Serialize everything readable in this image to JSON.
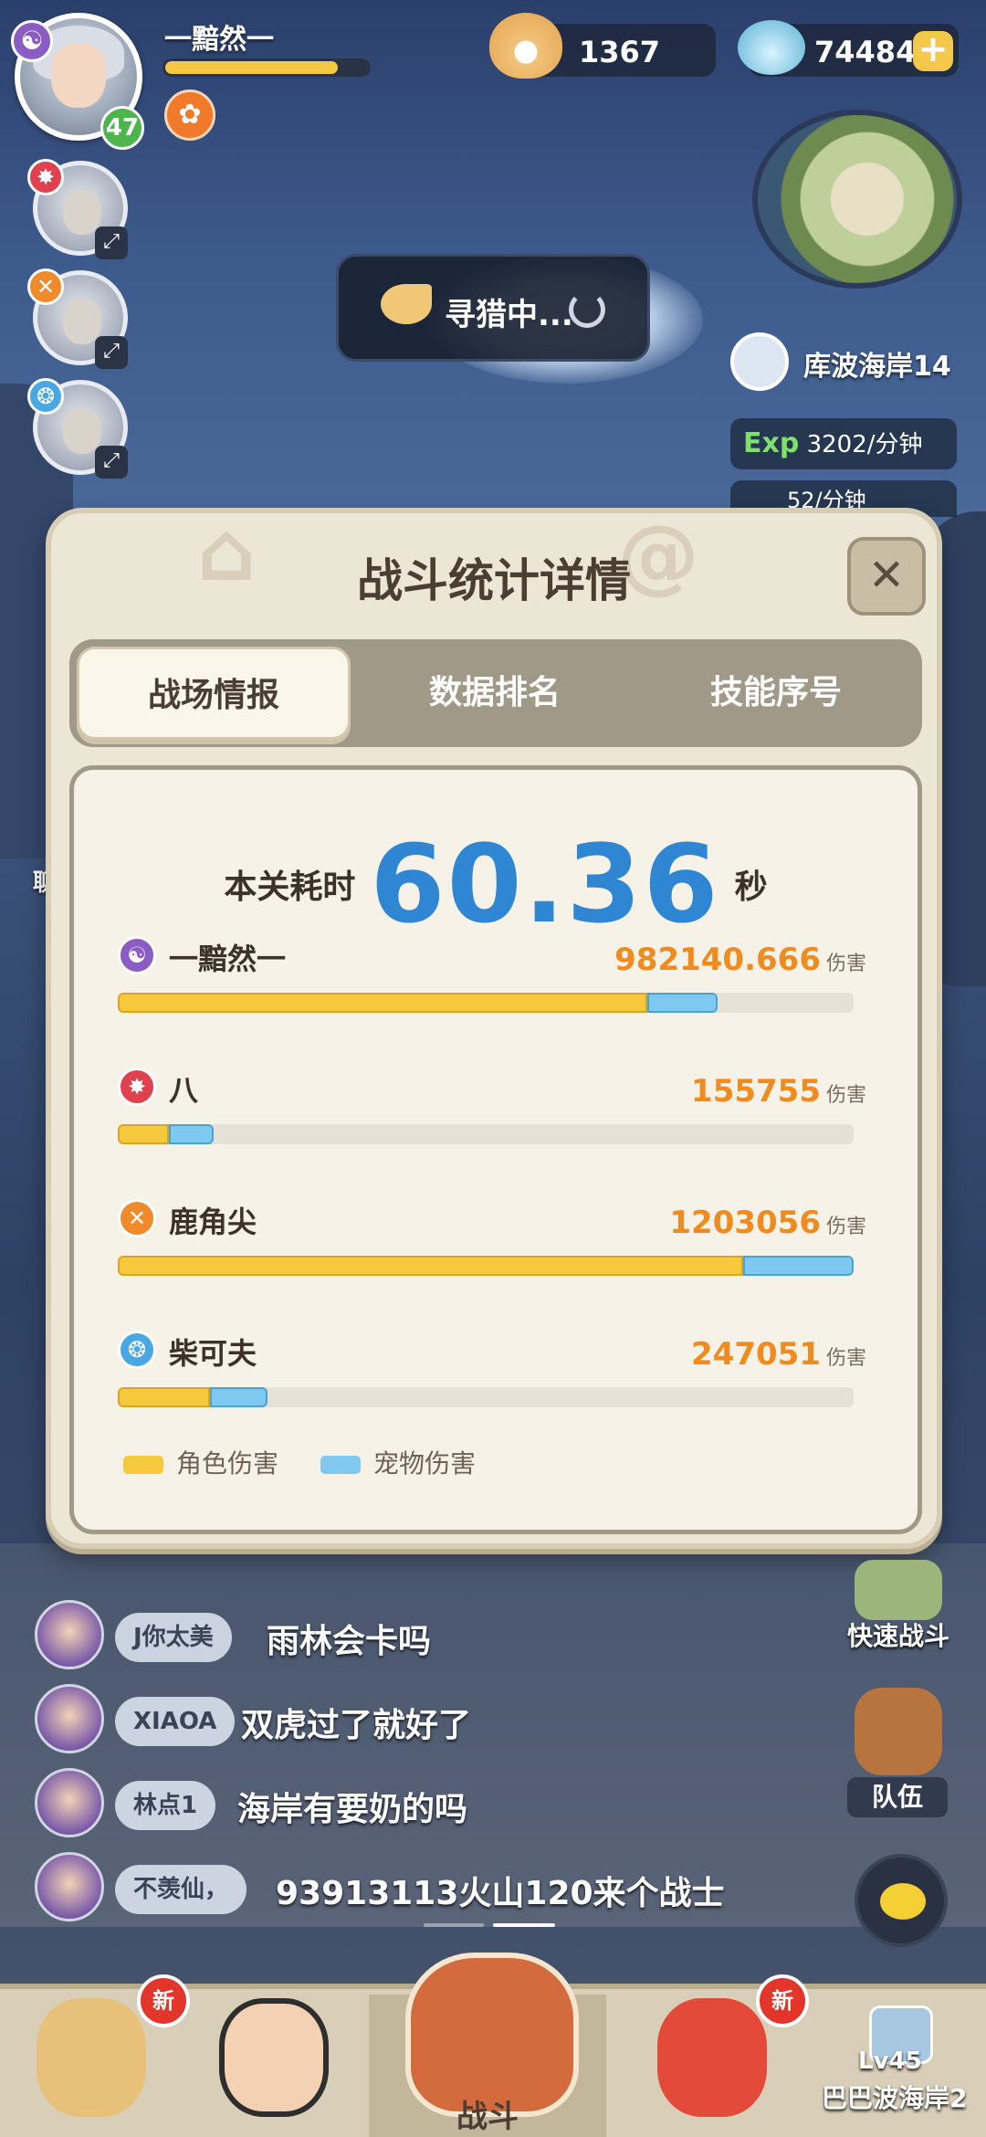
{
  "player": {
    "name": "一黯然一",
    "level": "47",
    "exp_progress": 0.85
  },
  "currency": {
    "pearls": "1367",
    "shells": "74484"
  },
  "hunting": {
    "label": "寻猎中..."
  },
  "location": {
    "name": "库波海岸14",
    "exp_label": "Exp",
    "exp_rate": "3202/分钟",
    "second_rate": "52/分钟"
  },
  "panel": {
    "title": "战斗统计详情",
    "close": "✕",
    "tabs": [
      {
        "label": "战场情报"
      },
      {
        "label": "数据排名"
      },
      {
        "label": "技能序号"
      }
    ],
    "time_label": "本关耗时",
    "time_value": "60.36",
    "time_unit": "秒",
    "damage_unit": "伤害",
    "players": [
      {
        "name": "一黯然一",
        "damage": "982140.666",
        "role_pct": 72,
        "pet_pct": 9.5,
        "element_color": "#8a5cc4",
        "icon": "☯"
      },
      {
        "name": "八",
        "damage": "155755",
        "role_pct": 7,
        "pet_pct": 6,
        "element_color": "#e0414f",
        "icon": "✸"
      },
      {
        "name": "鹿角尖",
        "damage": "1203056",
        "role_pct": 85,
        "pet_pct": 15,
        "element_color": "#f08a2a",
        "icon": "✕"
      },
      {
        "name": "柴可夫",
        "damage": "247051",
        "role_pct": 12.5,
        "pet_pct": 7.8,
        "element_color": "#4aa7e6",
        "icon": "❂"
      }
    ],
    "legend": [
      {
        "label": "角色伤害",
        "color": "#f6c83c"
      },
      {
        "label": "宠物伤害",
        "color": "#7fc8f0"
      }
    ]
  },
  "chat_side_label": "聊天",
  "chat": [
    {
      "tag": "J你太美",
      "message": "雨林会卡吗"
    },
    {
      "tag": "XIAOA",
      "message": "双虎过了就好了"
    },
    {
      "tag": "林点1",
      "message": "海岸有要奶的吗"
    },
    {
      "tag": "不羡仙，",
      "message": "93913113火山120来个战士"
    }
  ],
  "side_buttons": {
    "fast_battle": "快速战斗",
    "team": "队伍"
  },
  "bottom_nav": {
    "new_badge": "新",
    "battle": "战斗",
    "locked_level": "Lv45",
    "locked_map": "巴巴波海岸2"
  }
}
